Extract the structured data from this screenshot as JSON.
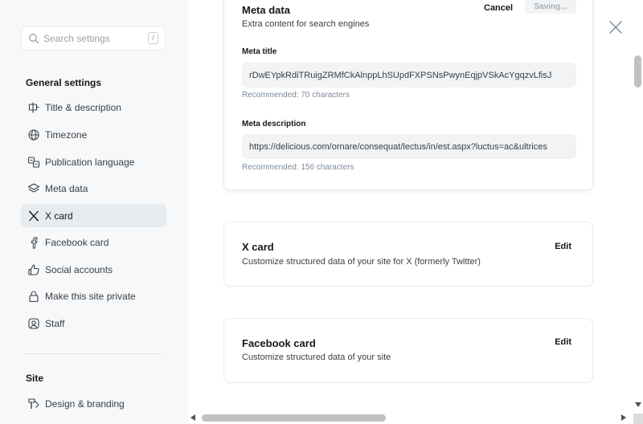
{
  "search": {
    "placeholder": "Search settings",
    "shortcut": "/"
  },
  "sidebar": {
    "group_general": "General settings",
    "items": [
      {
        "label": "Title & description",
        "icon": "title-icon"
      },
      {
        "label": "Timezone",
        "icon": "globe-icon"
      },
      {
        "label": "Publication language",
        "icon": "language-icon"
      },
      {
        "label": "Meta data",
        "icon": "layers-icon"
      },
      {
        "label": "X card",
        "icon": "x-logo-icon"
      },
      {
        "label": "Facebook card",
        "icon": "facebook-icon"
      },
      {
        "label": "Social accounts",
        "icon": "thumbs-up-icon"
      },
      {
        "label": "Make this site private",
        "icon": "lock-icon"
      },
      {
        "label": "Staff",
        "icon": "staff-icon"
      }
    ],
    "active_item": "X card",
    "group_site": "Site",
    "site_items": [
      {
        "label": "Design & branding",
        "icon": "paintbrush-icon"
      }
    ]
  },
  "meta_card": {
    "title": "Meta data",
    "description": "Extra content for search engines",
    "cancel_label": "Cancel",
    "saving_label": "Saving...",
    "meta_title_label": "Meta title",
    "meta_title_value": "rDwEYpkRdiTRuigZRMfCkAlnppLhSUpdFXPSNsPwynEqjpVSkAcYgqzvLfisJ",
    "meta_title_hint": "Recommended: 70 characters",
    "meta_description_label": "Meta description",
    "meta_description_value": "https://delicious.com/ornare/consequat/lectus/in/est.aspx?luctus=ac&ultrices",
    "meta_description_hint": "Recommended: 156 characters"
  },
  "x_card": {
    "title": "X card",
    "description": "Customize structured data of your site for X (formerly Twitter)",
    "edit_label": "Edit"
  },
  "facebook_card": {
    "title": "Facebook card",
    "description": "Customize structured data of your site",
    "edit_label": "Edit"
  },
  "colors": {
    "sidebar_bg": "#f7f8f9",
    "active_item_bg": "#e8ebee",
    "input_bg": "#f1f3f4",
    "text": "#15171a",
    "muted": "#7c8b9a"
  }
}
